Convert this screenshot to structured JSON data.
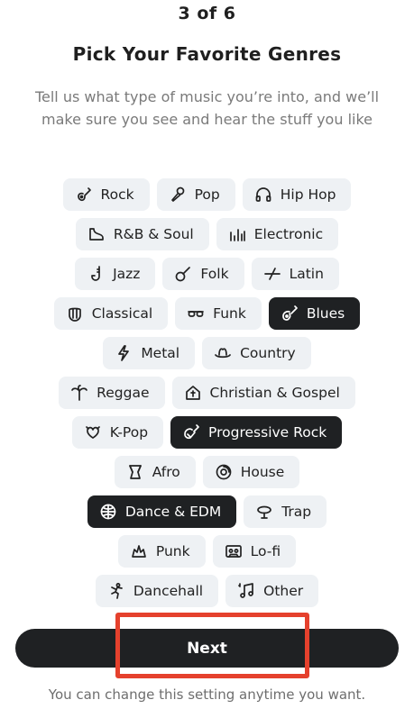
{
  "header": {
    "step": "3 of 6",
    "title": "Pick Your Favorite Genres",
    "subtitle": "Tell us what type of music you’re into, and we’ll make sure you see and hear the stuff you like"
  },
  "genres": [
    {
      "label": "Rock",
      "icon": "electric-guitar-icon",
      "selected": false
    },
    {
      "label": "Pop",
      "icon": "microphone-icon",
      "selected": false
    },
    {
      "label": "Hip Hop",
      "icon": "headphones-icon",
      "selected": false
    },
    {
      "label": "R&B & Soul",
      "icon": "piano-icon",
      "selected": false
    },
    {
      "label": "Electronic",
      "icon": "equalizer-icon",
      "selected": false
    },
    {
      "label": "Jazz",
      "icon": "saxophone-icon",
      "selected": false
    },
    {
      "label": "Folk",
      "icon": "banjo-icon",
      "selected": false
    },
    {
      "label": "Latin",
      "icon": "maracas-icon",
      "selected": false
    },
    {
      "label": "Classical",
      "icon": "harp-icon",
      "selected": false
    },
    {
      "label": "Funk",
      "icon": "sunglasses-icon",
      "selected": false
    },
    {
      "label": "Blues",
      "icon": "acoustic-guitar-icon",
      "selected": true
    },
    {
      "label": "Metal",
      "icon": "lightning-icon",
      "selected": false
    },
    {
      "label": "Country",
      "icon": "cowboy-hat-icon",
      "selected": false
    },
    {
      "label": "Reggae",
      "icon": "palm-tree-icon",
      "selected": false
    },
    {
      "label": "Christian & Gospel",
      "icon": "church-icon",
      "selected": false
    },
    {
      "label": "K-Pop",
      "icon": "heart-icon",
      "selected": false
    },
    {
      "label": "Progressive Rock",
      "icon": "guitar-icon",
      "selected": true
    },
    {
      "label": "Afro",
      "icon": "drum-icon",
      "selected": false
    },
    {
      "label": "House",
      "icon": "vinyl-icon",
      "selected": false
    },
    {
      "label": "Dance & EDM",
      "icon": "disco-ball-icon",
      "selected": true
    },
    {
      "label": "Trap",
      "icon": "trap-icon",
      "selected": false
    },
    {
      "label": "Punk",
      "icon": "punk-icon",
      "selected": false
    },
    {
      "label": "Lo-fi",
      "icon": "cassette-icon",
      "selected": false
    },
    {
      "label": "Dancehall",
      "icon": "dancer-icon",
      "selected": false
    },
    {
      "label": "Other",
      "icon": "music-note-icon",
      "selected": false
    }
  ],
  "actions": {
    "next_label": "Next"
  },
  "footer": {
    "note": "You can change this setting anytime you want."
  },
  "colors": {
    "chip_background": "#eef1f4",
    "chip_selected": "#1f2123",
    "highlight": "#e5412d"
  }
}
